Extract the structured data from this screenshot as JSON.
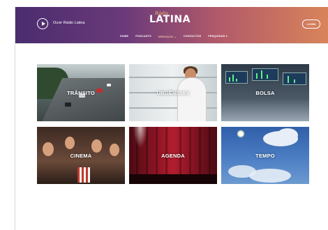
{
  "header": {
    "listen_label": "Ouvir Rádio Latina",
    "logo_small": "Rádio",
    "logo_big": "LATINA",
    "login_label": "LOGIN"
  },
  "nav": {
    "items": [
      "HOME",
      "PODCASTS",
      "SERVIÇOS",
      "CONTACTOS",
      "PESQUISAR"
    ]
  },
  "tiles": [
    {
      "label": "TRÂNSITO"
    },
    {
      "label": "URGÊNCIAS"
    },
    {
      "label": "BOLSA"
    },
    {
      "label": "CINEMA"
    },
    {
      "label": "AGENDA"
    },
    {
      "label": "TEMPO"
    }
  ],
  "icons": {
    "play": "play-icon",
    "search": "search-icon",
    "dropdown": "chevron-down-icon"
  },
  "colors": {
    "header_start": "#4a2c6e",
    "header_end": "#d9845a",
    "logo_accent": "#f2c36b"
  }
}
